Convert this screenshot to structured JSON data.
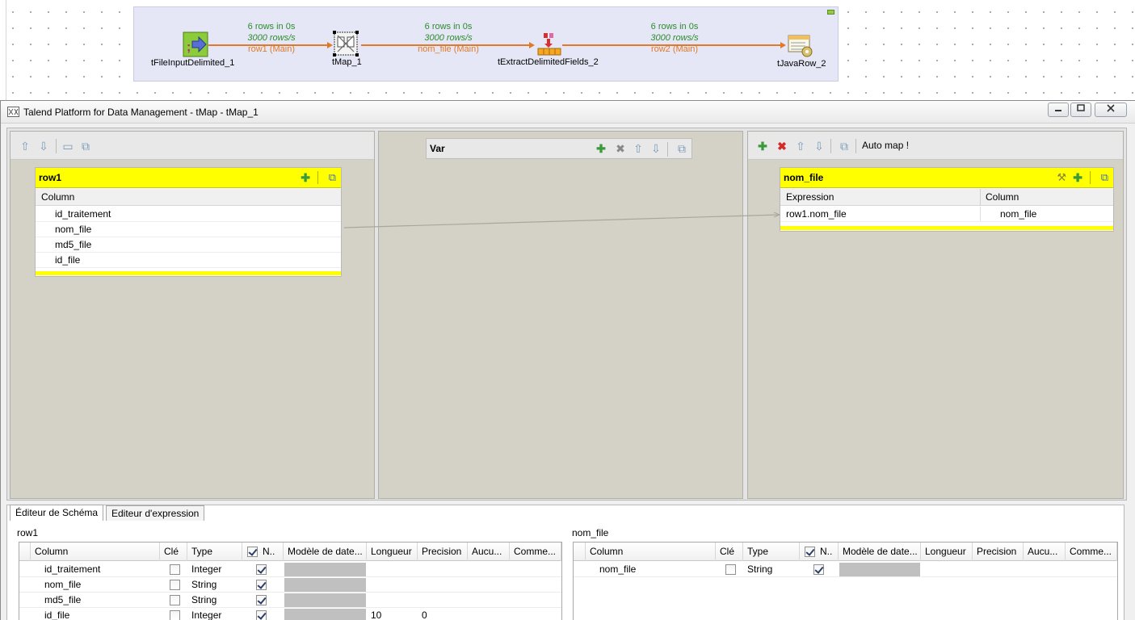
{
  "job": {
    "components": [
      {
        "name": "tFileInputDelimited_1",
        "icon": "file-input-delimited-icon"
      },
      {
        "name": "tMap_1",
        "icon": "tmap-icon"
      },
      {
        "name": "tExtractDelimitedFields_2",
        "icon": "extract-delimited-fields-icon"
      },
      {
        "name": "tJavaRow_2",
        "icon": "java-row-icon"
      }
    ],
    "flows": [
      {
        "stat_rows": "6 rows in 0s",
        "stat_rate": "3000 rows/s",
        "label": "row1 (Main)"
      },
      {
        "stat_rows": "6 rows in 0s",
        "stat_rate": "3000 rows/s",
        "label": "nom_file (Main)"
      },
      {
        "stat_rows": "6 rows in 0s",
        "stat_rate": "3000 rows/s",
        "label": "row2 (Main)"
      }
    ],
    "colors": {
      "subjob_bg": "#e5e7f6",
      "flow": "#e07a2a",
      "stats": "#2e8b2e"
    }
  },
  "window": {
    "title": "Talend Platform for Data Management  - tMap - tMap_1",
    "buttons": {
      "minimize": "minimize-icon",
      "maximize": "maximize-icon",
      "close": "close-icon"
    }
  },
  "input_zone": {
    "table": {
      "name": "row1",
      "column_header": "Column",
      "rows": [
        "id_traitement",
        "nom_file",
        "md5_file",
        "id_file"
      ]
    }
  },
  "var_zone": {
    "title": "Var"
  },
  "output_zone": {
    "auto_map": "Auto map !",
    "table": {
      "name": "nom_file",
      "headers": {
        "expression": "Expression",
        "column": "Column"
      },
      "rows": [
        {
          "expression": "row1.nom_file",
          "column": "nom_file"
        }
      ]
    }
  },
  "bottom": {
    "tabs": [
      "Éditeur de  Schéma",
      "Editeur d'expression"
    ],
    "active_tab": 0,
    "headers": [
      "Column",
      "Clé",
      "Type",
      "N..",
      "Modèle de date...",
      "Longueur",
      "Precision",
      "Aucu...",
      "Comme..."
    ],
    "left": {
      "title": "row1",
      "rows": [
        {
          "column": "id_traitement",
          "key": false,
          "type": "Integer",
          "nullable": true,
          "length": "",
          "precision": ""
        },
        {
          "column": "nom_file",
          "key": false,
          "type": "String",
          "nullable": true,
          "length": "",
          "precision": ""
        },
        {
          "column": "md5_file",
          "key": false,
          "type": "String",
          "nullable": true,
          "length": "",
          "precision": ""
        },
        {
          "column": "id_file",
          "key": false,
          "type": "Integer",
          "nullable": true,
          "length": "10",
          "precision": "0"
        }
      ]
    },
    "right": {
      "title": "nom_file",
      "rows": [
        {
          "column": "nom_file",
          "key": false,
          "type": "String",
          "nullable": true,
          "length": "",
          "precision": ""
        }
      ]
    }
  }
}
